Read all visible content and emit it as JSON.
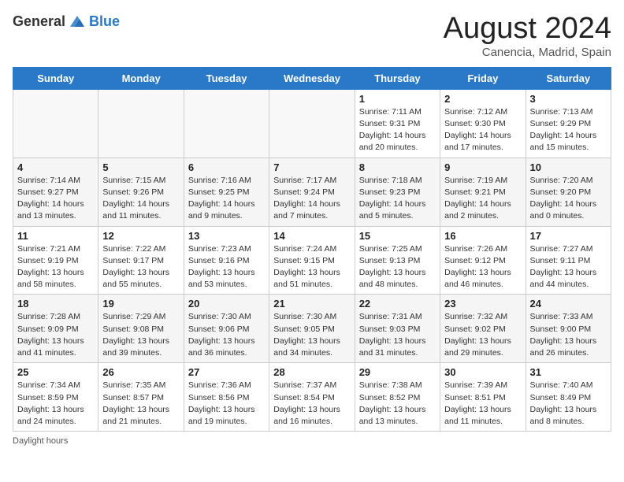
{
  "logo": {
    "general": "General",
    "blue": "Blue"
  },
  "title": "August 2024",
  "subtitle": "Canencia, Madrid, Spain",
  "days_of_week": [
    "Sunday",
    "Monday",
    "Tuesday",
    "Wednesday",
    "Thursday",
    "Friday",
    "Saturday"
  ],
  "footer": "Daylight hours",
  "weeks": [
    [
      {
        "day": "",
        "info": ""
      },
      {
        "day": "",
        "info": ""
      },
      {
        "day": "",
        "info": ""
      },
      {
        "day": "",
        "info": ""
      },
      {
        "day": "1",
        "info": "Sunrise: 7:11 AM\nSunset: 9:31 PM\nDaylight: 14 hours and 20 minutes."
      },
      {
        "day": "2",
        "info": "Sunrise: 7:12 AM\nSunset: 9:30 PM\nDaylight: 14 hours and 17 minutes."
      },
      {
        "day": "3",
        "info": "Sunrise: 7:13 AM\nSunset: 9:29 PM\nDaylight: 14 hours and 15 minutes."
      }
    ],
    [
      {
        "day": "4",
        "info": "Sunrise: 7:14 AM\nSunset: 9:27 PM\nDaylight: 14 hours and 13 minutes."
      },
      {
        "day": "5",
        "info": "Sunrise: 7:15 AM\nSunset: 9:26 PM\nDaylight: 14 hours and 11 minutes."
      },
      {
        "day": "6",
        "info": "Sunrise: 7:16 AM\nSunset: 9:25 PM\nDaylight: 14 hours and 9 minutes."
      },
      {
        "day": "7",
        "info": "Sunrise: 7:17 AM\nSunset: 9:24 PM\nDaylight: 14 hours and 7 minutes."
      },
      {
        "day": "8",
        "info": "Sunrise: 7:18 AM\nSunset: 9:23 PM\nDaylight: 14 hours and 5 minutes."
      },
      {
        "day": "9",
        "info": "Sunrise: 7:19 AM\nSunset: 9:21 PM\nDaylight: 14 hours and 2 minutes."
      },
      {
        "day": "10",
        "info": "Sunrise: 7:20 AM\nSunset: 9:20 PM\nDaylight: 14 hours and 0 minutes."
      }
    ],
    [
      {
        "day": "11",
        "info": "Sunrise: 7:21 AM\nSunset: 9:19 PM\nDaylight: 13 hours and 58 minutes."
      },
      {
        "day": "12",
        "info": "Sunrise: 7:22 AM\nSunset: 9:17 PM\nDaylight: 13 hours and 55 minutes."
      },
      {
        "day": "13",
        "info": "Sunrise: 7:23 AM\nSunset: 9:16 PM\nDaylight: 13 hours and 53 minutes."
      },
      {
        "day": "14",
        "info": "Sunrise: 7:24 AM\nSunset: 9:15 PM\nDaylight: 13 hours and 51 minutes."
      },
      {
        "day": "15",
        "info": "Sunrise: 7:25 AM\nSunset: 9:13 PM\nDaylight: 13 hours and 48 minutes."
      },
      {
        "day": "16",
        "info": "Sunrise: 7:26 AM\nSunset: 9:12 PM\nDaylight: 13 hours and 46 minutes."
      },
      {
        "day": "17",
        "info": "Sunrise: 7:27 AM\nSunset: 9:11 PM\nDaylight: 13 hours and 44 minutes."
      }
    ],
    [
      {
        "day": "18",
        "info": "Sunrise: 7:28 AM\nSunset: 9:09 PM\nDaylight: 13 hours and 41 minutes."
      },
      {
        "day": "19",
        "info": "Sunrise: 7:29 AM\nSunset: 9:08 PM\nDaylight: 13 hours and 39 minutes."
      },
      {
        "day": "20",
        "info": "Sunrise: 7:30 AM\nSunset: 9:06 PM\nDaylight: 13 hours and 36 minutes."
      },
      {
        "day": "21",
        "info": "Sunrise: 7:30 AM\nSunset: 9:05 PM\nDaylight: 13 hours and 34 minutes."
      },
      {
        "day": "22",
        "info": "Sunrise: 7:31 AM\nSunset: 9:03 PM\nDaylight: 13 hours and 31 minutes."
      },
      {
        "day": "23",
        "info": "Sunrise: 7:32 AM\nSunset: 9:02 PM\nDaylight: 13 hours and 29 minutes."
      },
      {
        "day": "24",
        "info": "Sunrise: 7:33 AM\nSunset: 9:00 PM\nDaylight: 13 hours and 26 minutes."
      }
    ],
    [
      {
        "day": "25",
        "info": "Sunrise: 7:34 AM\nSunset: 8:59 PM\nDaylight: 13 hours and 24 minutes."
      },
      {
        "day": "26",
        "info": "Sunrise: 7:35 AM\nSunset: 8:57 PM\nDaylight: 13 hours and 21 minutes."
      },
      {
        "day": "27",
        "info": "Sunrise: 7:36 AM\nSunset: 8:56 PM\nDaylight: 13 hours and 19 minutes."
      },
      {
        "day": "28",
        "info": "Sunrise: 7:37 AM\nSunset: 8:54 PM\nDaylight: 13 hours and 16 minutes."
      },
      {
        "day": "29",
        "info": "Sunrise: 7:38 AM\nSunset: 8:52 PM\nDaylight: 13 hours and 13 minutes."
      },
      {
        "day": "30",
        "info": "Sunrise: 7:39 AM\nSunset: 8:51 PM\nDaylight: 13 hours and 11 minutes."
      },
      {
        "day": "31",
        "info": "Sunrise: 7:40 AM\nSunset: 8:49 PM\nDaylight: 13 hours and 8 minutes."
      }
    ]
  ]
}
